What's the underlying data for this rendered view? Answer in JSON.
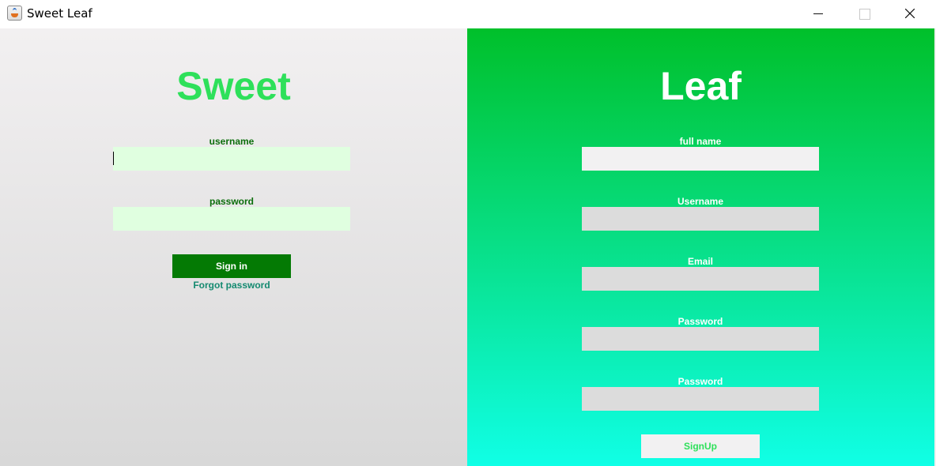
{
  "window": {
    "title": "Sweet Leaf"
  },
  "signin": {
    "heading": "Sweet",
    "username_label": "username",
    "password_label": "password",
    "signin_label": "Sign in",
    "forgot_label": "Forgot password"
  },
  "signup": {
    "heading": "Leaf",
    "fullname_label": "full name",
    "username_label": "Username",
    "email_label": "Email",
    "password_label": "Password",
    "confirm_password_label": "Password",
    "signup_label": "SignUp"
  },
  "icons": {
    "app": "java-app-icon",
    "minimize": "minimize-icon",
    "maximize": "maximize-icon",
    "close": "close-icon"
  },
  "colors": {
    "sweet_heading": "#2ee05a",
    "signin_button": "#047a04",
    "left_field_bg": "#e0ffe0",
    "right_gradient_top": "#00c02a",
    "right_gradient_bottom": "#10ffe6",
    "forgot_link": "#148a70"
  }
}
